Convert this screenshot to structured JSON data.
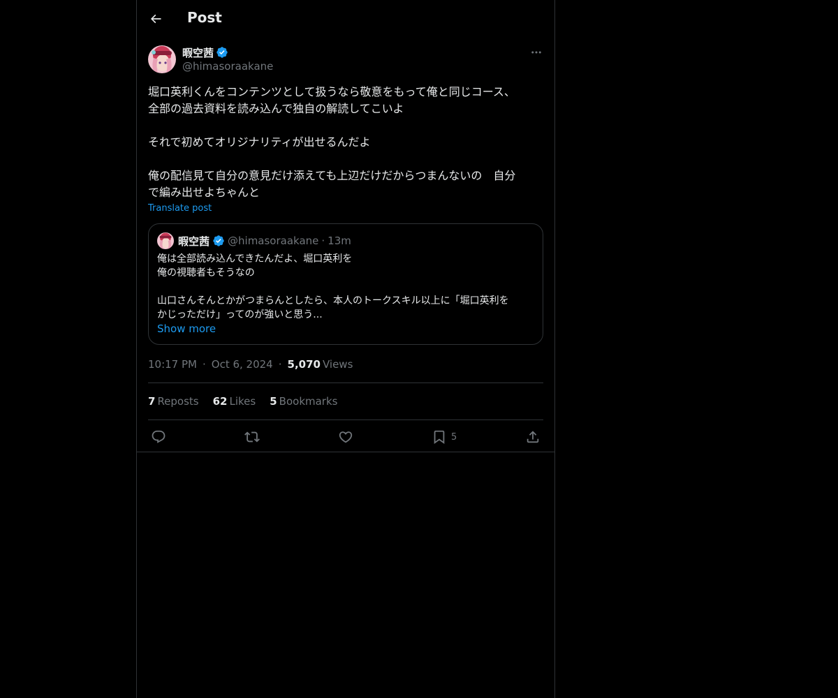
{
  "header": {
    "title": "Post"
  },
  "post": {
    "author_name": "暇空茜",
    "author_handle": "@himasoraakane",
    "text_lines": [
      "堀口英利くんをコンテンツとして扱うなら敬意をもって俺と同じコース、",
      "全部の過去資料を読み込んで独自の解読してこいよ",
      "",
      "それで初めてオリジナリティが出せるんだよ",
      "",
      "俺の配信見て自分の意見だけ添えても上辺だけだからつまんないの　自分",
      "で編み出せよちゃんと"
    ],
    "translate_label": "Translate post",
    "time": "10:17 PM",
    "date": "Oct 6, 2024",
    "views_count": "5,070",
    "views_label": "Views"
  },
  "quote": {
    "author_name": "暇空茜",
    "author_handle": "@himasoraakane",
    "dot": "·",
    "time": "13m",
    "text_lines": [
      "俺は全部読み込んできたんだよ、堀口英利を",
      "俺の視聴者もそうなの",
      "",
      "山口さんそんとかがつまらんとしたら、本人のトークスキル以上に「堀口英利を",
      "かじっただけ」ってのが強いと思う..."
    ],
    "show_more": "Show more"
  },
  "meta": {
    "dot": "·"
  },
  "stats": {
    "reposts_count": "7",
    "reposts_label": "Reposts",
    "likes_count": "62",
    "likes_label": "Likes",
    "bookmarks_count": "5",
    "bookmarks_label": "Bookmarks"
  },
  "actions": {
    "reply_icon": "reply-icon",
    "repost_icon": "repost-icon",
    "like_icon": "heart-icon",
    "bookmark_icon": "bookmark-icon",
    "bookmark_count": "5",
    "share_icon": "share-icon"
  },
  "colors": {
    "background": "#000000",
    "text": "#e7e9ea",
    "secondary": "#71767b",
    "accent": "#1d9bf0",
    "border": "#2f3336",
    "verified": "#1d9bf0"
  }
}
